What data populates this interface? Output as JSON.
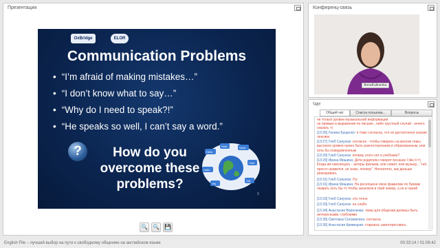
{
  "presentation": {
    "title": "Презентация",
    "slide": {
      "logo_left": "OxBridge",
      "logo_right": "ELOR",
      "heading": "Communication Problems",
      "bullets": [
        "“I’m afraid of making mistakes…”",
        "“I don’t know what to say…”",
        "“Why do I need to speak?!”",
        "“He speaks so well, I can’t say a word.”"
      ],
      "question_mark": "?",
      "question_lines": [
        "How do you",
        "overcome these",
        "problems?"
      ],
      "page_number": "5",
      "globe_words": [
        "Hello",
        "Hola",
        "Salut",
        "Ciao",
        "Hallo",
        "Olá",
        "Hej"
      ]
    },
    "tools": {
      "zoom_in_icon": "🔍",
      "zoom_out_icon": "🔍",
      "save_icon": "💾"
    }
  },
  "conference": {
    "title": "Конференц-связь",
    "participant_name": "AnnaKalinenka"
  },
  "chat": {
    "title": "Чат",
    "tabs": [
      "Общий чат",
      "Список пользова...",
      "Вопросы"
    ],
    "messages": [
      {
        "time": "",
        "user": "",
        "text": "не только уровни музыкальной информации"
      },
      {
        "time": "",
        "user": "",
        "text": "не прямые в выражения по письме...либо грустный случай - нечего сказать +("
      },
      {
        "time": "[13:26]",
        "user": "Галина Бущенко:",
        "text": "я тоже согласна, что не достаточное знание лексики"
      },
      {
        "time": "[13:27]",
        "user": "Глеб Сапунов:",
        "text": "согласен - чтобы говорить на многие темы высокого уровня нужно быть разносторонним и образованным, или хоть бы осведомленным"
      },
      {
        "time": "[13:29]",
        "user": "Глеб Сапунов:",
        "text": "почему этого нет в учебнике?"
      },
      {
        "time": "[13:29]",
        "user": "Ирина Мишина:",
        "text": "Дети родителю говорят because I like it =) Когда им наконецать - актеры фильма, или сюжет, или музыку... \"нет, просто нравится, не знаю, почему\". Непонятно, как дальше реагировать"
      },
      {
        "time": "[13:31]",
        "user": "Глеб Сапунов:",
        "text": "Угу"
      },
      {
        "time": "[13:31]",
        "user": "Ирина Мишина:",
        "text": "На ресепшене свою фамилию по буквам назвать хоть бы =) Чтобы заселили в твой номер, а не в чужой"
      },
      {
        "time": "[13:33]",
        "user": "Глеб Сапунов:",
        "text": "это точно"
      },
      {
        "time": "[13:33]",
        "user": "Глеб Сапунов:",
        "text": "на слабо"
      },
      {
        "time": "[13:34]",
        "user": "Анастасия Воронкова:",
        "text": "темы для общения должны быть интересными, глубокими"
      },
      {
        "time": "[13:35]",
        "user": "Светлана Соломатина:",
        "text": "согласна"
      },
      {
        "time": "[13:36]",
        "user": "Анастасия Кривецкая:",
        "text": "стараюсь заинтересовать"
      }
    ]
  },
  "status": {
    "title": "English File – лучший выбор на пути к свободному общению на английском языке",
    "time": "00:33:14 / 01:06:42"
  }
}
